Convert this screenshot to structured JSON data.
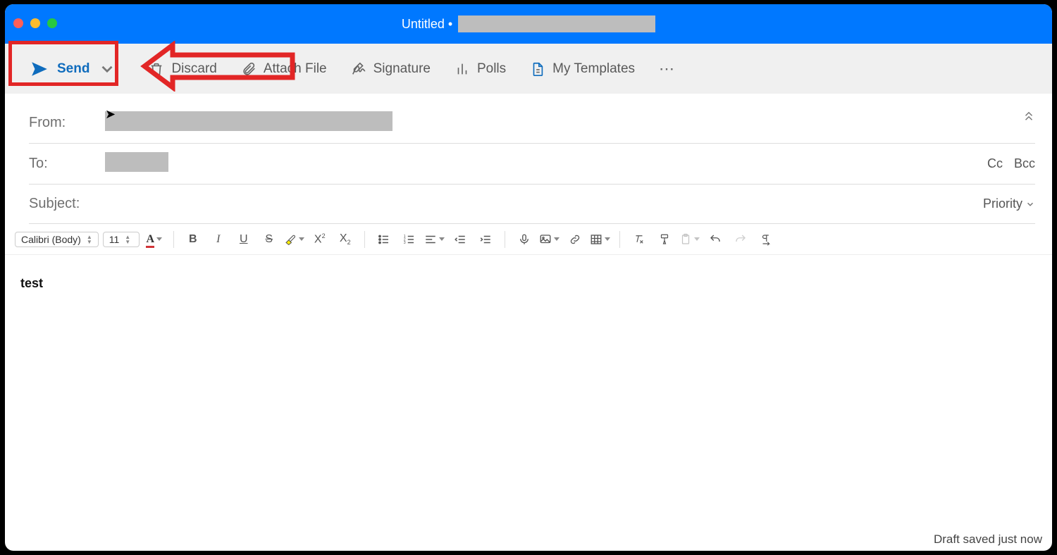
{
  "window": {
    "title": "Untitled •"
  },
  "toolbar": {
    "send": "Send",
    "discard": "Discard",
    "attach": "Attach File",
    "signature": "Signature",
    "polls": "Polls",
    "templates": "My Templates"
  },
  "fields": {
    "from_label": "From:",
    "to_label": "To:",
    "subject_label": "Subject:",
    "cc": "Cc",
    "bcc": "Bcc",
    "priority": "Priority"
  },
  "format": {
    "font_name": "Calibri (Body)",
    "font_size": "11"
  },
  "body": {
    "text": "test"
  },
  "status": {
    "draft": "Draft saved just now"
  }
}
